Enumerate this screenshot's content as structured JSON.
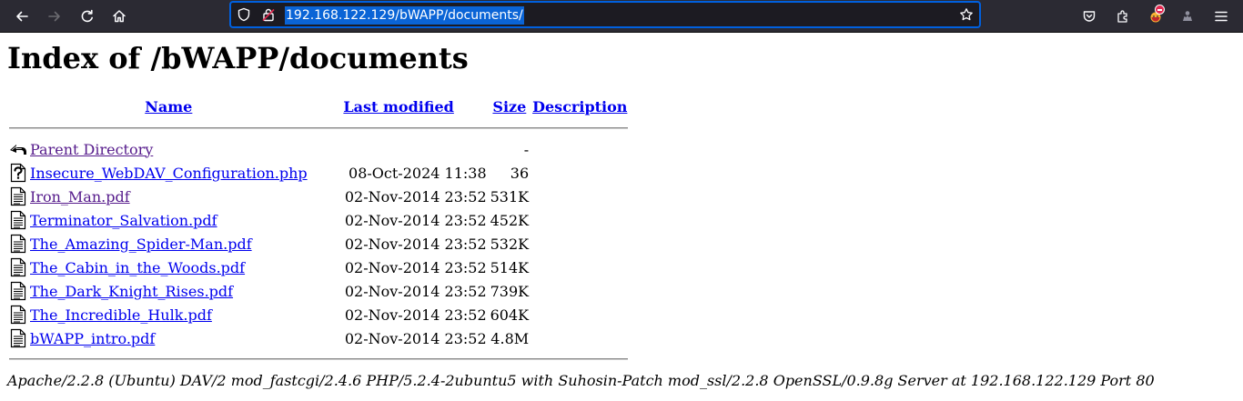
{
  "browser": {
    "url": "192.168.122.129/bWAPP/documents/"
  },
  "page": {
    "title": "Index of /bWAPP/documents",
    "columns": {
      "name": "Name",
      "last_modified": "Last modified",
      "size": "Size",
      "description": "Description"
    },
    "parent": {
      "name": "Parent Directory",
      "size": "-",
      "icon": "back-icon"
    },
    "files": [
      {
        "name": "Insecure_WebDAV_Configuration.php",
        "modified": "08-Oct-2024 11:38",
        "size": "36",
        "icon": "unknown-file-icon",
        "visited": false
      },
      {
        "name": "Iron_Man.pdf",
        "modified": "02-Nov-2014 23:52",
        "size": "531K",
        "icon": "document-icon",
        "visited": true
      },
      {
        "name": "Terminator_Salvation.pdf",
        "modified": "02-Nov-2014 23:52",
        "size": "452K",
        "icon": "document-icon",
        "visited": false
      },
      {
        "name": "The_Amazing_Spider-Man.pdf",
        "modified": "02-Nov-2014 23:52",
        "size": "532K",
        "icon": "document-icon",
        "visited": false
      },
      {
        "name": "The_Cabin_in_the_Woods.pdf",
        "modified": "02-Nov-2014 23:52",
        "size": "514K",
        "icon": "document-icon",
        "visited": false
      },
      {
        "name": "The_Dark_Knight_Rises.pdf",
        "modified": "02-Nov-2014 23:52",
        "size": "739K",
        "icon": "document-icon",
        "visited": false
      },
      {
        "name": "The_Incredible_Hulk.pdf",
        "modified": "02-Nov-2014 23:52",
        "size": "604K",
        "icon": "document-icon",
        "visited": false
      },
      {
        "name": "bWAPP_intro.pdf",
        "modified": "02-Nov-2014 23:52",
        "size": "4.8M",
        "icon": "document-icon",
        "visited": false
      }
    ],
    "footer": "Apache/2.2.8 (Ubuntu) DAV/2 mod_fastcgi/2.4.6 PHP/5.2.4-2ubuntu5 with Suhosin-Patch mod_ssl/2.2.8 OpenSSL/0.9.8g Server at 192.168.122.129 Port 80"
  },
  "colors": {
    "toolbar_bg": "#2b2a33",
    "urlbar_bg": "#1c1b22",
    "focus_ring": "#0060df",
    "link": "#0000ee",
    "visited_link": "#551a8b"
  }
}
